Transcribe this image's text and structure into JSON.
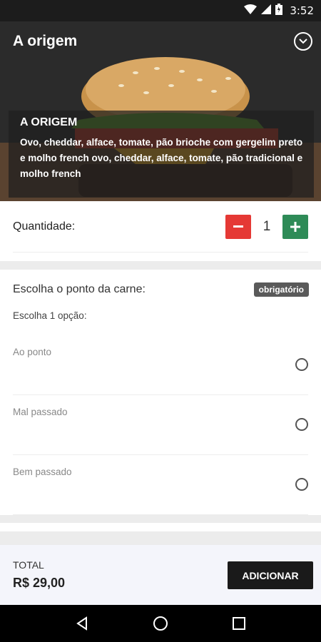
{
  "status_bar": {
    "time": "3:52",
    "icons": [
      "wifi-icon",
      "signal-icon",
      "battery-icon"
    ]
  },
  "app_bar": {
    "title": "A origem",
    "action_icon": "chevron-down-circle-icon"
  },
  "product": {
    "name": "A ORIGEM",
    "description": "Ovo, cheddar, alface, tomate, pão brioche com gergelim preto e molho french ovo, cheddar, alface, tomate, pão tradicional e molho french"
  },
  "quantity": {
    "label": "Quantidade:",
    "value": "1"
  },
  "options": {
    "title": "Escolha o ponto da carne:",
    "badge": "obrigatório",
    "subtitle": "Escolha 1 opção:",
    "items": [
      {
        "label": "Ao ponto"
      },
      {
        "label": "Mal passado"
      },
      {
        "label": "Bem passado"
      }
    ]
  },
  "footer": {
    "total_label": "TOTAL",
    "total_value": "R$ 29,00",
    "add_button": "ADICIONAR"
  },
  "colors": {
    "minus": "#e53935",
    "plus": "#2e8b57",
    "add": "#1a1a1a"
  }
}
